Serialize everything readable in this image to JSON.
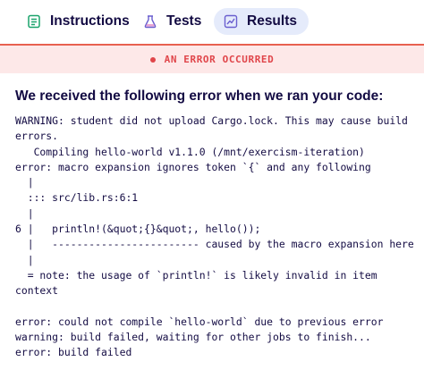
{
  "tabs": [
    {
      "label": "Instructions",
      "icon": "instructions-icon",
      "active": false
    },
    {
      "label": "Tests",
      "icon": "tests-icon",
      "active": false
    },
    {
      "label": "Results",
      "icon": "results-icon",
      "active": true
    }
  ],
  "banner": {
    "text": "AN ERROR OCCURRED",
    "color": "#e0454a"
  },
  "heading": "We received the following error when we ran your code:",
  "log_lines": [
    "WARNING: student did not upload Cargo.lock. This may cause build",
    "errors.",
    "   Compiling hello-world v1.1.0 (/mnt/exercism-iteration)",
    "error: macro expansion ignores token `{` and any following",
    "  |",
    "  ::: src/lib.rs:6:1",
    "  |",
    "6 |   println!(&quot;{}&quot;, hello());",
    "  |   ------------------------ caused by the macro expansion here",
    "  |",
    "  = note: the usage of `println!` is likely invalid in item",
    "context",
    "",
    "error: could not compile `hello-world` due to previous error",
    "warning: build failed, waiting for other jobs to finish...",
    "error: build failed"
  ]
}
